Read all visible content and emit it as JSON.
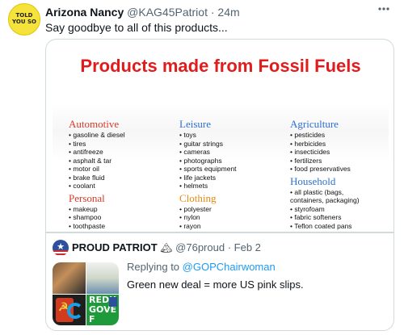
{
  "tweet": {
    "author_name": "Arizona Nancy",
    "author_handle": "@KAG45Patriot",
    "separator": "·",
    "time": "24m",
    "avatar_text": "TOLD YOU SO",
    "text": "Say goodbye to all of this products...",
    "more_icon": "more-horizontal-icon"
  },
  "infographic": {
    "title": "Products made from Fossil Fuels",
    "columns": [
      {
        "sections": [
          {
            "heading": "Automotive",
            "color": "#d43b2a",
            "items": [
              "gasoline & diesel",
              "tires",
              "antifreeze",
              "asphalt & tar",
              "motor oil",
              "brake fluid",
              "coolant"
            ]
          },
          {
            "heading": "Personal",
            "color": "#d43b2a",
            "items": [
              "makeup",
              "shampoo",
              "toothpaste"
            ]
          }
        ]
      },
      {
        "sections": [
          {
            "heading": "Leisure",
            "color": "#2e6fd4",
            "items": [
              "toys",
              "guitar strings",
              "cameras",
              "photographs",
              "sports equipment",
              "life jackets",
              "helmets"
            ]
          },
          {
            "heading": "Clothing",
            "color": "#e28a15",
            "items": [
              "polyester",
              "nylon",
              "rayon"
            ]
          }
        ]
      },
      {
        "sections": [
          {
            "heading": "Agriculture",
            "color": "#2e6fd4",
            "items": [
              "pesticides",
              "herbicides",
              "insecticides",
              "fertilizers",
              "food preservatives"
            ]
          },
          {
            "heading": "Household",
            "color": "#2e6fd4",
            "items": [
              "all plastic (bags,",
              "containers, packaging)",
              "styrofoam",
              "fabric softeners",
              "Teflon coated pans"
            ]
          }
        ]
      }
    ]
  },
  "quoted": {
    "author_name": "PROUD PATRIOT",
    "emoji": "🏔",
    "author_handle": "@76proud",
    "separator": "·",
    "time": "Feb 2",
    "replying_prefix": "Replying to ",
    "replying_to": "@GOPChairwoman",
    "text": "Green new deal = more US pink slips.",
    "media_tiles": [
      {
        "label": "",
        "icon": "photo-tile"
      },
      {
        "label": "",
        "icon": "photo-tile"
      },
      {
        "label": "",
        "icon": "hammer-sickle-tile"
      },
      {
        "label": "REDU GOVE F",
        "icon": "text-poster-tile"
      }
    ]
  }
}
